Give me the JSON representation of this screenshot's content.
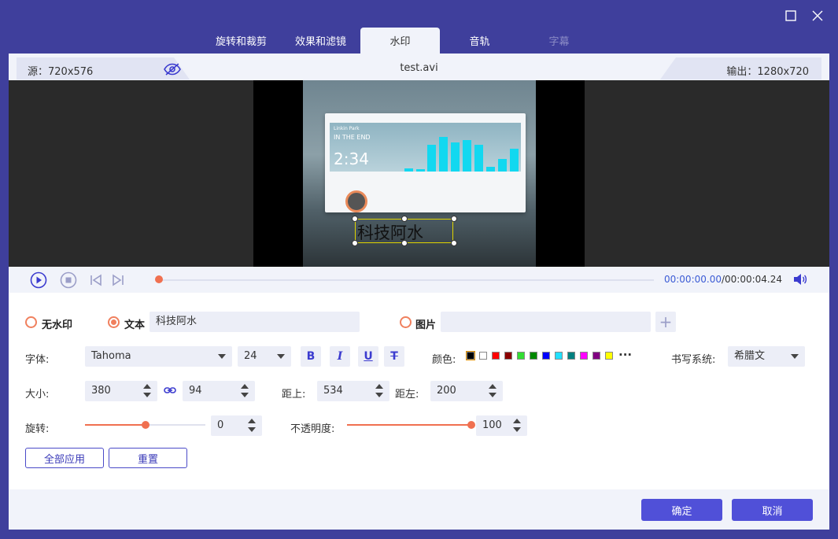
{
  "tabs": [
    {
      "label": "旋转和裁剪",
      "state": "normal"
    },
    {
      "label": "效果和滤镜",
      "state": "normal"
    },
    {
      "label": "水印",
      "state": "active"
    },
    {
      "label": "音轨",
      "state": "normal"
    },
    {
      "label": "字幕",
      "state": "disabled"
    }
  ],
  "info": {
    "source": "源：720x576",
    "filename": "test.avi",
    "output": "输出：1280x720"
  },
  "preview": {
    "player_artist": "Linkin Park",
    "player_title": "IN THE END",
    "player_time": "2:34",
    "watermark_text": "科技阿水"
  },
  "playback": {
    "current": "00:00:00.00",
    "total": "/00:00:04.24",
    "progress": 0.0
  },
  "watermark_options": {
    "none_label": "无水印",
    "text_label": "文本",
    "text_value": "科技阿水",
    "image_label": "图片",
    "selected": "text"
  },
  "font": {
    "label": "字体:",
    "family": "Tahoma",
    "size": "24",
    "bold": "B",
    "italic": "I",
    "underline": "U",
    "strike": "T"
  },
  "color": {
    "label": "颜色:",
    "swatches": [
      "#000000",
      "#ffffff",
      "#ff0000",
      "#8b0000",
      "#33dd33",
      "#008800",
      "#0000ff",
      "#22e0ff",
      "#008080",
      "#ff00ff",
      "#800080",
      "#ffff00"
    ],
    "selected": "#000000",
    "more": "···"
  },
  "writing_system": {
    "label": "书写系统:",
    "value": "希腊文"
  },
  "size": {
    "label": "大小:",
    "width": "380",
    "height": "94"
  },
  "position": {
    "top_label": "距上:",
    "top": "534",
    "left_label": "距左:",
    "left": "200"
  },
  "rotation": {
    "label": "旋转:",
    "value": "0",
    "level": 0.5
  },
  "opacity": {
    "label": "不透明度:",
    "value": "100",
    "level": 1.0
  },
  "actions": {
    "apply_all": "全部应用",
    "reset": "重置",
    "ok": "确定",
    "cancel": "取消"
  }
}
